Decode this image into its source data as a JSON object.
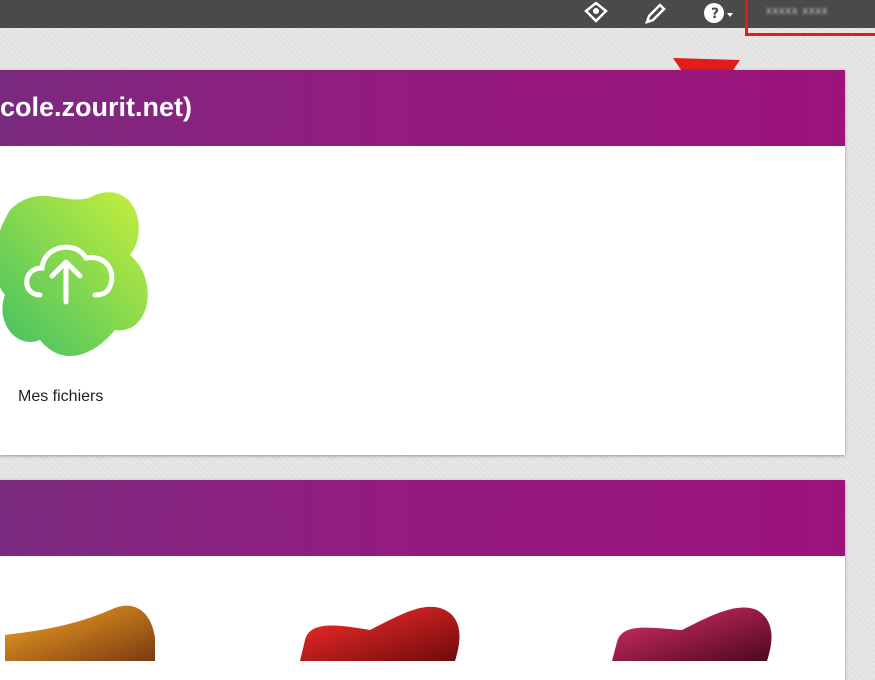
{
  "topbar": {
    "icons": [
      "notification-icon",
      "pencil-icon",
      "help-icon"
    ],
    "user_label": "xxxxx xxxx"
  },
  "panel_one": {
    "title": "cole.zourit.net)",
    "apps": [
      {
        "label": "Mes fichiers",
        "icon": "cloud-upload-icon",
        "gradient": [
          "#c8f03a",
          "#3fbf66"
        ]
      }
    ]
  },
  "panel_two": {
    "title": "",
    "apps": [
      {
        "icon": "orange-app-icon",
        "gradient": [
          "#f5a623",
          "#a0521b"
        ]
      },
      {
        "icon": "red-app-icon",
        "gradient": [
          "#ff2d2d",
          "#8b0d0d"
        ]
      },
      {
        "icon": "crimson-app-icon",
        "gradient": [
          "#e0306a",
          "#6d0d2e"
        ]
      }
    ]
  },
  "annotation": {
    "color": "#e31b1b"
  },
  "colors": {
    "header_start": "#7a2a7e",
    "header_end": "#9c137c",
    "topbar": "#4a4a4a"
  }
}
